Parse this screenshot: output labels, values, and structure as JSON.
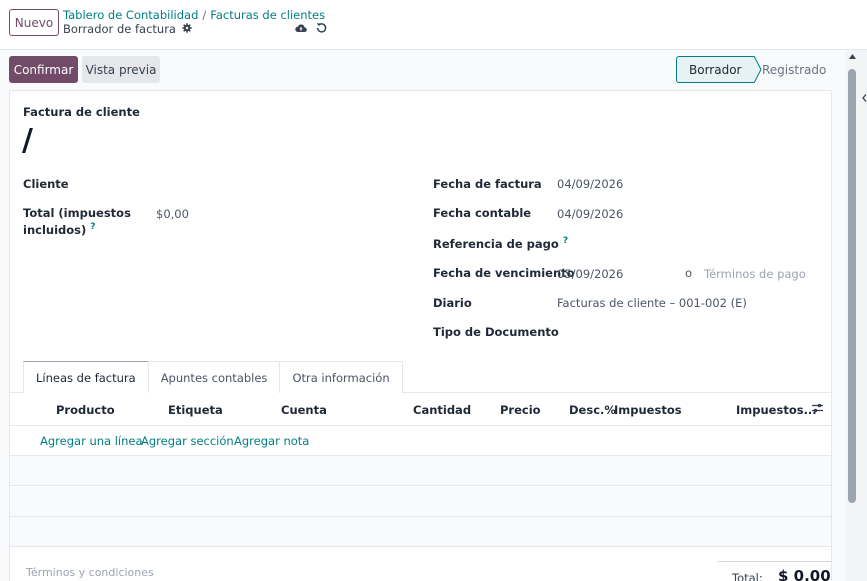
{
  "topbar": {
    "new_button": "Nuevo",
    "breadcrumb": {
      "parent": "Tablero de Contabilidad",
      "separator": "/",
      "current": "Facturas de clientes"
    },
    "record_title": "Borrador de factura",
    "icons": [
      "gear-icon",
      "cloud-upload-icon",
      "discard-icon"
    ]
  },
  "actions": {
    "confirm": "Confirmar",
    "preview": "Vista previa"
  },
  "statusbar": {
    "stages": [
      "Borrador",
      "Registrado"
    ],
    "active": "Borrador"
  },
  "form": {
    "type_label": "Factura de cliente",
    "number": "/",
    "left": {
      "cliente_label": "Cliente",
      "total_label_line1": "Total (impuestos",
      "total_label_line2": "incluidos)",
      "total_help": "?",
      "total_value": "$0,00"
    },
    "right": {
      "invoice_date_label": "Fecha de factura",
      "invoice_date": "04/09/2026",
      "accounting_date_label": "Fecha contable",
      "accounting_date": "04/09/2026",
      "payment_ref_label": "Referencia de pago",
      "payment_ref_help": "?",
      "due_date_label": "Fecha de vencimiento",
      "due_date": "05/09/2026",
      "due_or": "o",
      "payment_terms_placeholder": "Términos de pago",
      "journal_label": "Diario",
      "journal": "Facturas de cliente – 001-002 (E)",
      "doc_type_label": "Tipo de Documento"
    }
  },
  "tabs": [
    "Líneas de factura",
    "Apuntes contables",
    "Otra información"
  ],
  "lines_table": {
    "columns": [
      "Producto",
      "Etiqueta",
      "Cuenta",
      "Cantidad",
      "Precio",
      "Desc.%",
      "Impuestos",
      "Impuestos..."
    ],
    "add_links": [
      "Agregar una línea",
      "Agregar sección",
      "Agregar nota"
    ]
  },
  "footer": {
    "terms_placeholder": "Términos y condiciones",
    "total_label": "Total:",
    "total_value": "$ 0.00"
  },
  "colors": {
    "primary": "#714b67",
    "link": "#017e84"
  }
}
